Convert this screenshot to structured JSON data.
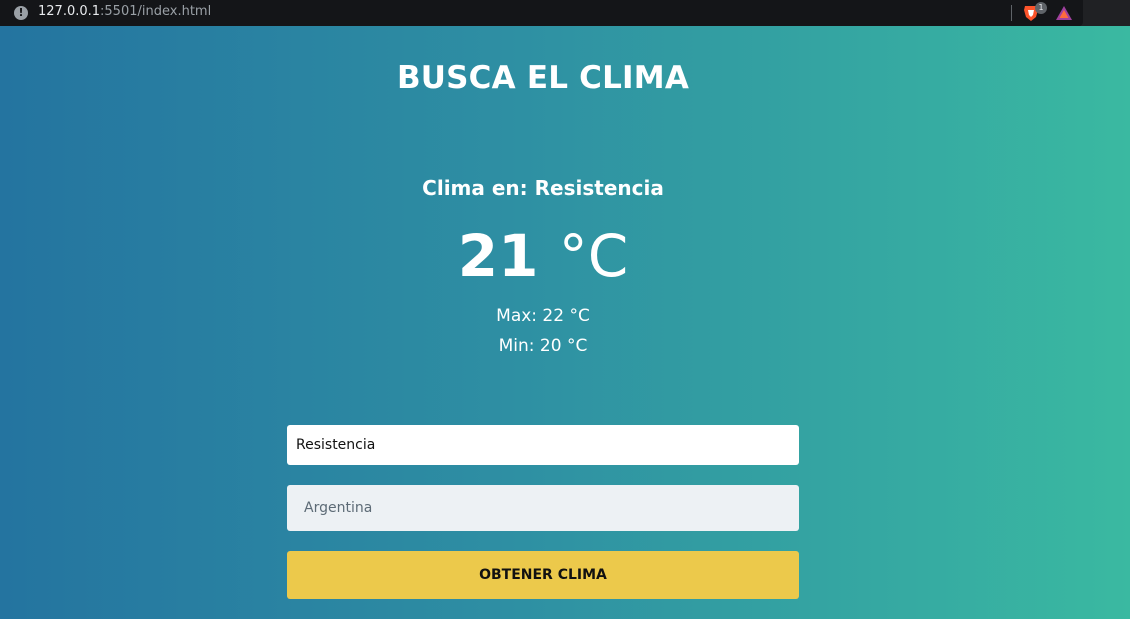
{
  "browser": {
    "info_icon": "!",
    "url_host": "127.0.0.1",
    "url_rest": ":5501/index.html",
    "brave_badge": "1",
    "icons": {
      "shields": "brave-shields-icon",
      "rewards": "brave-rewards-icon"
    }
  },
  "app": {
    "title": "BUSCA EL CLIMA",
    "heading": "Clima en: Resistencia",
    "temperature": {
      "value": "21",
      "unit": "°C"
    },
    "max": "Max: 22 °C",
    "min": "Min: 20 °C"
  },
  "form": {
    "city_value": "Resistencia",
    "country_placeholder": "Argentina",
    "submit_label": "OBTENER CLIMA"
  },
  "colors": {
    "gradient_start": "#2474a0",
    "gradient_end": "#3ab9a1",
    "button": "#ecc94b"
  }
}
